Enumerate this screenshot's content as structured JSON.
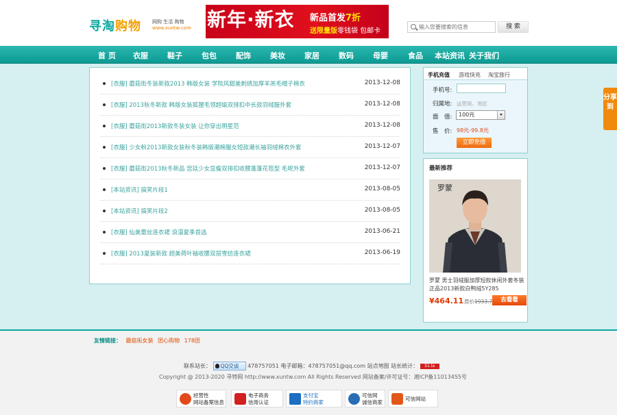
{
  "header": {
    "logo_text_a": "寻淘",
    "logo_text_b": "购物",
    "logo_tagline": "网购 生活 购物",
    "logo_url": "www.xuntw.com",
    "banner_main": "新年·新衣",
    "banner_line1_a": "新品首发",
    "banner_line1_b": "7折",
    "banner_line2_a": "送限量版",
    "banner_line2_b": "零钱袋 包邮卡",
    "search_placeholder": "输入您要搜索的信息",
    "search_button": "搜 索"
  },
  "nav": {
    "items": [
      "首 页",
      "衣服",
      "鞋子",
      "包包",
      "配饰",
      "美妆",
      "家居",
      "数码",
      "母婴",
      "食品",
      "本站资讯",
      "关于我们"
    ]
  },
  "articles": [
    {
      "title": "[衣服] 蘑菇街冬装新款2013 韩版女装 学院风甜美刺绣加厚羊羔毛帽子棉衣",
      "date": "2013-12-08"
    },
    {
      "title": "[衣服] 2013秋冬新款 韩版女装狐狸毛领超级双排扣中长款羽绒服外套",
      "date": "2013-12-08"
    },
    {
      "title": "[衣服] 蘑菇街2013新款冬装女装 让你穿出明星范",
      "date": "2013-12-08"
    },
    {
      "title": "[衣服] 少女粉2013新款女装秋冬装韩版潮棉服女短款潮长袖羽绒棉衣外套",
      "date": "2013-12-07"
    },
    {
      "title": "[衣服] 蘑菇街2013秋冬新品 宫廷少女显瘦双排扣收腰蓬蓬花苞型 毛呢外套",
      "date": "2013-12-07"
    },
    {
      "title": "[本站资讯] 搞笑片段1",
      "date": "2013-08-05"
    },
    {
      "title": "[本站资讯] 搞笑片段2",
      "date": "2013-08-05"
    },
    {
      "title": "[衣服] 仙美蕾丝连衣裙 浪漫夏季首选",
      "date": "2013-06-21"
    },
    {
      "title": "[衣服] 2013夏装新款 超美荷叶袖收腰双层雪纺连衣裙",
      "date": "2013-06-19"
    }
  ],
  "recharge": {
    "tabs": [
      "手机充值",
      "游戏快充",
      "淘宝旅行"
    ],
    "phone_label": "手机号:",
    "region_label": "归属地:",
    "region_hint": "运营商、地区",
    "amount_label": "面　值:",
    "amount_value": "100元",
    "price_label": "售　价:",
    "price_value": "98元-99.8元",
    "submit": "立即充值"
  },
  "recommend": {
    "title": "最新推荐",
    "photo_brand": "罗蒙",
    "desc": "罗蒙 男士羽绒服加厚短款休闲外套冬装正品2013新款白鸭绒5Y285",
    "price": "¥464.11",
    "old_price_label": "原价",
    "old_price": "1933.7",
    "buy": "去看看"
  },
  "share_label": "分享到",
  "footer": {
    "links_title": "友情链接：",
    "links": [
      "蘑菇街女装",
      "团心购物",
      "178团"
    ],
    "contact_prefix": "联系站长：",
    "qq_label": "QQ交谈",
    "contact_text": "478757051 电子邮箱：478757051@qq.com 站点地图 站长统计：",
    "stat_badge": "51.la",
    "copyright": "Copyright @ 2013-2020 寻特网 http://www.xuntw.com All Rights Reserved 网站备案/许可证号：湘ICP备11013455号",
    "badges": [
      {
        "l1": "经营性",
        "l2": "网站备案信息",
        "color": "#e24a1a"
      },
      {
        "l1": "电子商务",
        "l2": "信用认证",
        "color": "#d32020"
      },
      {
        "l1": "支付宝",
        "l2": "特约商家",
        "color": "#1b6ec2"
      },
      {
        "l1": "可信网",
        "l2": "诚信商家",
        "color": "#2a6db5"
      },
      {
        "l1": "可信网站",
        "l2": "",
        "color": "#e2571a"
      }
    ]
  }
}
